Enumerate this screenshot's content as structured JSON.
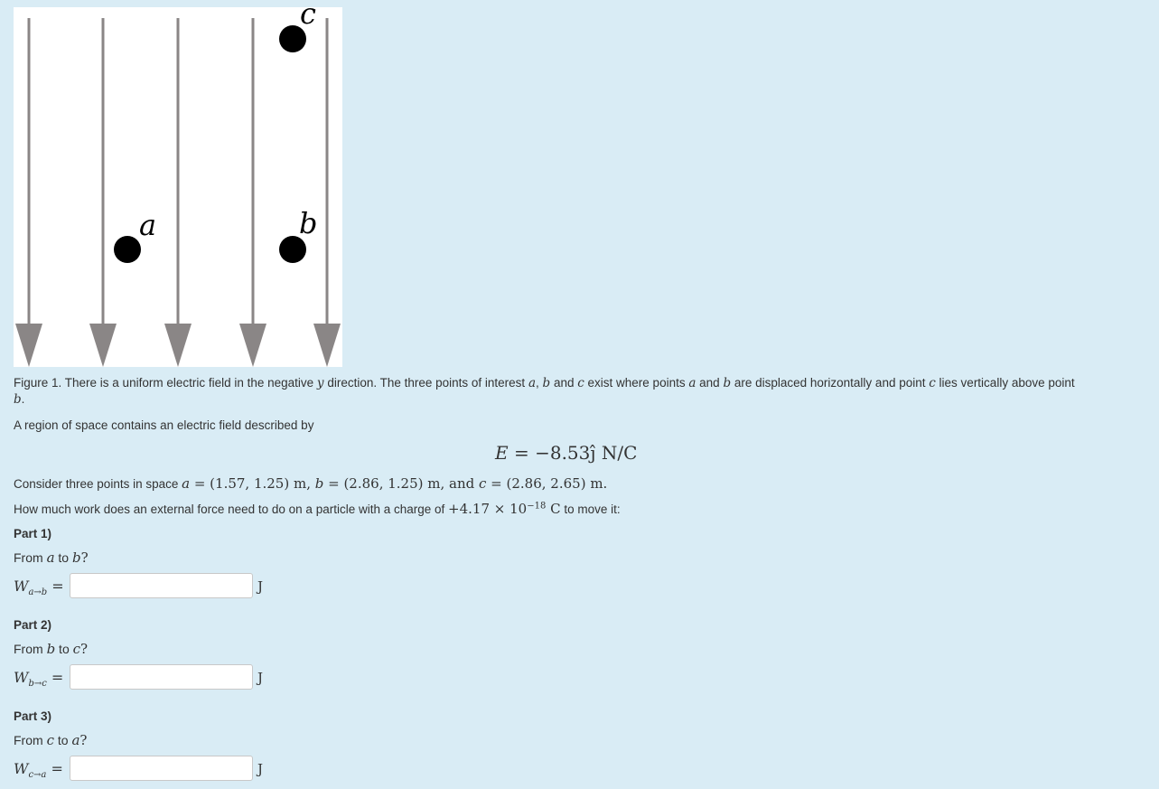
{
  "figure": {
    "point_a_label": "a",
    "point_b_label": "b",
    "point_c_label": "c",
    "arrow_color": "#8a8686",
    "point_color": "#000000"
  },
  "caption": {
    "prefix": "Figure 1. There is a uniform electric field in the negative ",
    "y": "y",
    "mid1": " direction. The three points of interest ",
    "a": "a",
    "comma": ", ",
    "b": "b",
    "and1": " and ",
    "c": "c",
    "mid2": " exist where points ",
    "a2": "a",
    "and2": " and ",
    "b2": "b",
    "mid3": " are displaced horizontally and point ",
    "c2": "c",
    "mid4": " lies vertically above point ",
    "b3": "b",
    "end": "."
  },
  "intro": "A region of space contains an electric field described by",
  "equation": {
    "lhs": "E",
    "rhs": " = −8.53ĵ N/C"
  },
  "points": {
    "prefix": "Consider three points in space ",
    "a": "a",
    "a_val": " = (1.57, 1.25) m, ",
    "b": "b",
    "b_val": " = (2.86, 1.25) m,  and ",
    "c": "c",
    "c_val": " = (2.86, 2.65) m."
  },
  "work_question": {
    "prefix": "How much work does an external force need to do on a particle with a charge of ",
    "charge": "+4.17 × 10",
    "exponent": "−18",
    "unit": " C",
    "suffix": " to move it:"
  },
  "parts": [
    {
      "title": "Part 1)",
      "from_label": "From ",
      "from": "a",
      "to_label": " to ",
      "to": "b",
      "q": "?",
      "w": "W",
      "sub": "a→b",
      "eq": " =",
      "value": "",
      "unit": "J"
    },
    {
      "title": "Part 2)",
      "from_label": "From ",
      "from": "b",
      "to_label": " to ",
      "to": "c",
      "q": "?",
      "w": "W",
      "sub": "b→c",
      "eq": " =",
      "value": "",
      "unit": "J"
    },
    {
      "title": "Part 3)",
      "from_label": "From ",
      "from": "c",
      "to_label": " to ",
      "to": "a",
      "q": "?",
      "w": "W",
      "sub": "c→a",
      "eq": " =",
      "value": "",
      "unit": "J"
    }
  ]
}
